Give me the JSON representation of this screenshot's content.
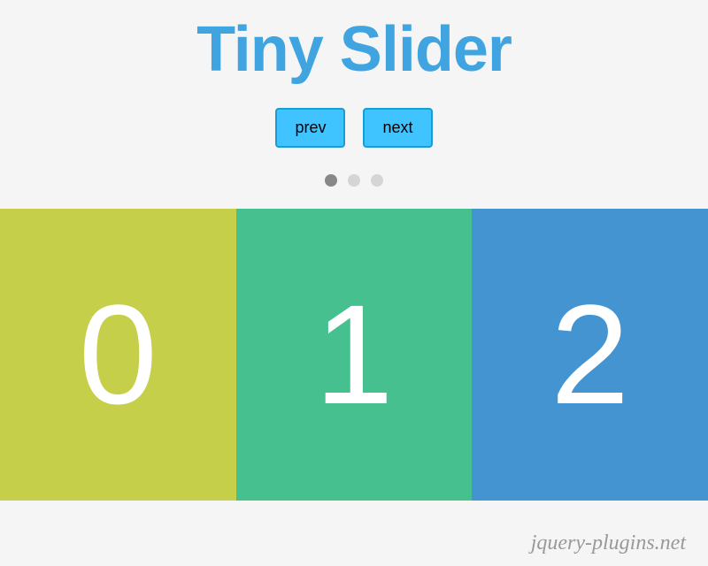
{
  "title": "Tiny Slider",
  "controls": {
    "prev_label": "prev",
    "next_label": "next"
  },
  "dots": {
    "count": 3,
    "active_index": 0
  },
  "slides": [
    {
      "value": "0",
      "color": "#c5cf4a"
    },
    {
      "value": "1",
      "color": "#47c08f"
    },
    {
      "value": "2",
      "color": "#4394d0"
    }
  ],
  "footer": "jquery-plugins.net"
}
